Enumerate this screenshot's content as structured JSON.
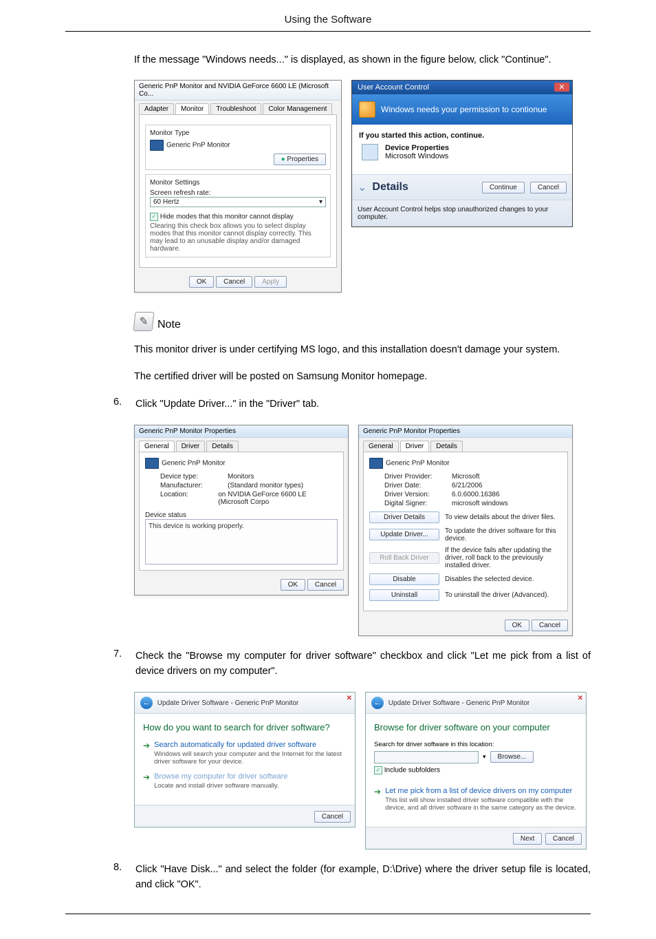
{
  "page_header": "Using the Software",
  "intro_text": "If the message \"Windows needs...\" is displayed, as shown in the figure below, click \"Continue\".",
  "monitor_dialog": {
    "title": "Generic PnP Monitor and NVIDIA GeForce 6600 LE (Microsoft Co...",
    "tabs": {
      "adapter": "Adapter",
      "monitor": "Monitor",
      "troubleshoot": "Troubleshoot",
      "color": "Color Management"
    },
    "type_group": "Monitor Type",
    "type_value": "Generic PnP Monitor",
    "properties_btn": "Properties",
    "settings_group": "Monitor Settings",
    "refresh_label": "Screen refresh rate:",
    "refresh_value": "60 Hertz",
    "hide_modes": "Hide modes that this monitor cannot display",
    "hide_desc": "Clearing this check box allows you to select display modes that this monitor cannot display correctly. This may lead to an unusable display and/or damaged hardware.",
    "ok": "OK",
    "cancel": "Cancel",
    "apply": "Apply"
  },
  "uac": {
    "title": "User Account Control",
    "banner": "Windows needs your permission to contionue",
    "started": "If you started this action, continue.",
    "dev_prop": "Device Properties",
    "ms_win": "Microsoft Windows",
    "details": "Details",
    "continue": "Continue",
    "cancel": "Cancel",
    "footer": "User Account Control helps stop unauthorized changes to your computer."
  },
  "note_label": "Note",
  "note_p1": "This monitor driver is under certifying MS logo, and this installation doesn't damage your system.",
  "note_p2": "The certified driver will be posted on Samsung Monitor homepage.",
  "step6_num": "6.",
  "step6_text": "Click \"Update Driver...\" in the \"Driver\" tab.",
  "props_general": {
    "title": "Generic PnP Monitor Properties",
    "tabs": {
      "general": "General",
      "driver": "Driver",
      "details": "Details"
    },
    "heading": "Generic PnP Monitor",
    "device_type_l": "Device type:",
    "device_type_v": "Monitors",
    "manufacturer_l": "Manufacturer:",
    "manufacturer_v": "(Standard monitor types)",
    "location_l": "Location:",
    "location_v": "on NVIDIA GeForce 6600 LE (Microsoft Corpo",
    "status_group": "Device status",
    "status_text": "This device is working properly.",
    "ok": "OK",
    "cancel": "Cancel"
  },
  "props_driver": {
    "title": "Generic PnP Monitor Properties",
    "tabs": {
      "general": "General",
      "driver": "Driver",
      "details": "Details"
    },
    "heading": "Generic PnP Monitor",
    "provider_l": "Driver Provider:",
    "provider_v": "Microsoft",
    "date_l": "Driver Date:",
    "date_v": "6/21/2006",
    "version_l": "Driver Version:",
    "version_v": "6.0.6000.16386",
    "signer_l": "Digital Signer:",
    "signer_v": "microsoft windows",
    "btn_details": "Driver Details",
    "desc_details": "To view details about the driver files.",
    "btn_update": "Update Driver...",
    "desc_update": "To update the driver software for this device.",
    "btn_rollback": "Roll Back Driver",
    "desc_rollback": "If the device fails after updating the driver, roll back to the previously installed driver.",
    "btn_disable": "Disable",
    "desc_disable": "Disables the selected device.",
    "btn_uninstall": "Uninstall",
    "desc_uninstall": "To uninstall the driver (Advanced).",
    "ok": "OK",
    "cancel": "Cancel"
  },
  "step7_num": "7.",
  "step7_text": "Check the \"Browse my computer for driver software\" checkbox and click \"Let me pick from a list of device drivers on my computer\".",
  "wizard1": {
    "crumb": "Update Driver Software - Generic PnP Monitor",
    "heading": "How do you want to search for driver software?",
    "opt1_title": "Search automatically for updated driver software",
    "opt1_sub": "Windows will search your computer and the Internet for the latest driver software for your device.",
    "opt2_title": "Browse my computer for driver software",
    "opt2_sub": "Locate and install driver software manually.",
    "cancel": "Cancel"
  },
  "wizard2": {
    "crumb": "Update Driver Software - Generic PnP Monitor",
    "heading": "Browse for driver software on your computer",
    "search_label": "Search for driver software in this location:",
    "browse": "Browse...",
    "include": "Include subfolders",
    "opt_title": "Let me pick from a list of device drivers on my computer",
    "opt_sub": "This list will show installed driver software compatible with the device, and all driver software in the same category as the device.",
    "next": "Next",
    "cancel": "Cancel"
  },
  "step8_num": "8.",
  "step8_text": "Click \"Have Disk...\" and select the folder (for example, D:\\Drive) where the driver setup file is located, and click \"OK\"."
}
